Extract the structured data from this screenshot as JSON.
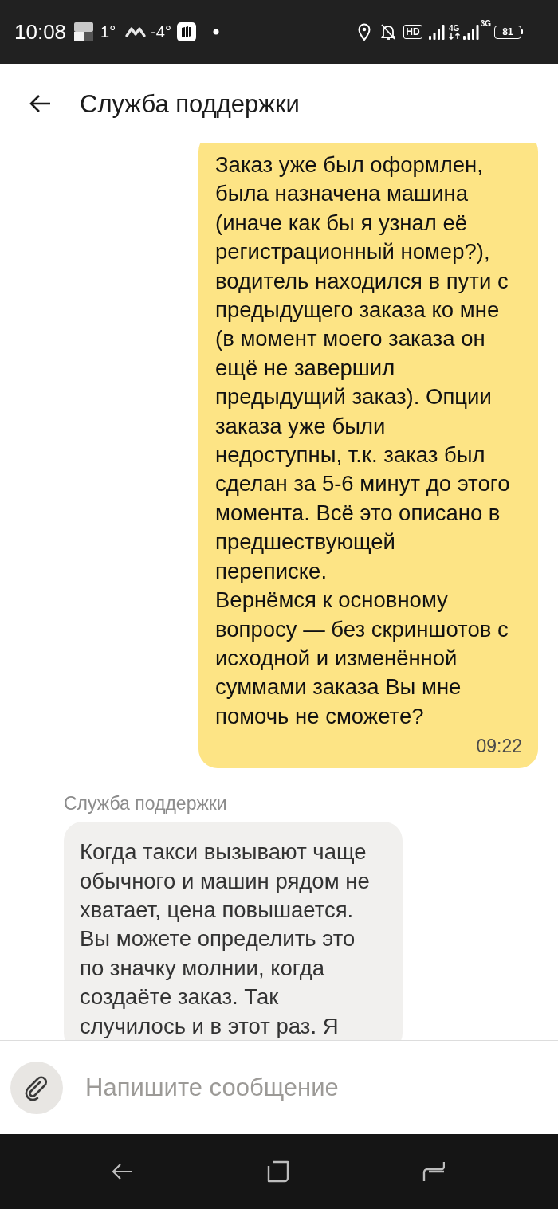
{
  "status_bar": {
    "time": "10:08",
    "temperature_1": "1°",
    "temperature_2": "-4°",
    "hd": "HD",
    "network_1": "4G",
    "network_2": "3G",
    "battery": "81"
  },
  "header": {
    "title": "Служба поддержки"
  },
  "messages": [
    {
      "kind": "outgoing",
      "text": "Заказ уже был оформлен,\nбыла назначена машина\n(иначе как бы я узнал её\nрегистрационный номер?),\nводитель находился в пути с\nпредыдущего заказа ко мне\n(в момент моего заказа он\nещё не завершил\nпредыдущий заказ). Опции\nзаказа уже были\nнедоступны, т.к. заказ был\nсделан за 5-6 минут до этого\nмомента. Всё это описано в\nпредшествующей\nпереписке.\nВернёмся к основному\nвопросу — без скриншотов с\nисходной и изменённой\nсуммами заказа Вы мне\nпомочь не сможете?",
      "time": "09:22"
    },
    {
      "kind": "incoming",
      "sender": "Служба поддержки",
      "text": "Когда такси вызывают чаще\nобычного и машин рядом не\nхватает, цена повышается.\nВы можете определить это\nпо значку молнии, когда\nсоздаёте заказ. Так\nслучилось и в этот раз. Я"
    }
  ],
  "composer": {
    "placeholder": "Напишите сообщение"
  }
}
